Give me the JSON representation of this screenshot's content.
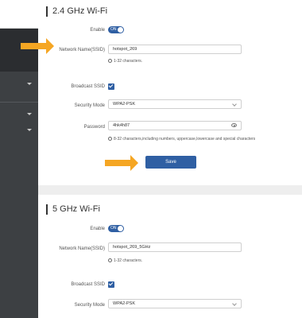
{
  "colors": {
    "accent": "#2f5fa3",
    "arrow": "#f5a623",
    "sidebar": "#3d4043"
  },
  "wifi24": {
    "title": "2.4 GHz Wi-Fi",
    "enable_label": "Enable",
    "toggle_text": "ON",
    "ssid_label": "Network Name(SSID)",
    "ssid_value": "hotspot_269",
    "ssid_hint": "1-32 characters.",
    "broadcast_label": "Broadcast SSID",
    "security_label": "Security Mode",
    "security_value": "WPA2-PSK",
    "password_label": "Password",
    "password_value": "4hk4h87",
    "password_hint": "8-32 characters,including numbers,  uppercase,lowercase and special characters",
    "save_label": "Save"
  },
  "wifi5": {
    "title": "5 GHz Wi-Fi",
    "enable_label": "Enable",
    "toggle_text": "ON",
    "ssid_label": "Network Name(SSID)",
    "ssid_value": "hotspot_269_5GHz",
    "ssid_hint": "1-32 characters.",
    "broadcast_label": "Broadcast SSID",
    "security_label": "Security Mode",
    "security_value": "WPA2-PSK"
  }
}
